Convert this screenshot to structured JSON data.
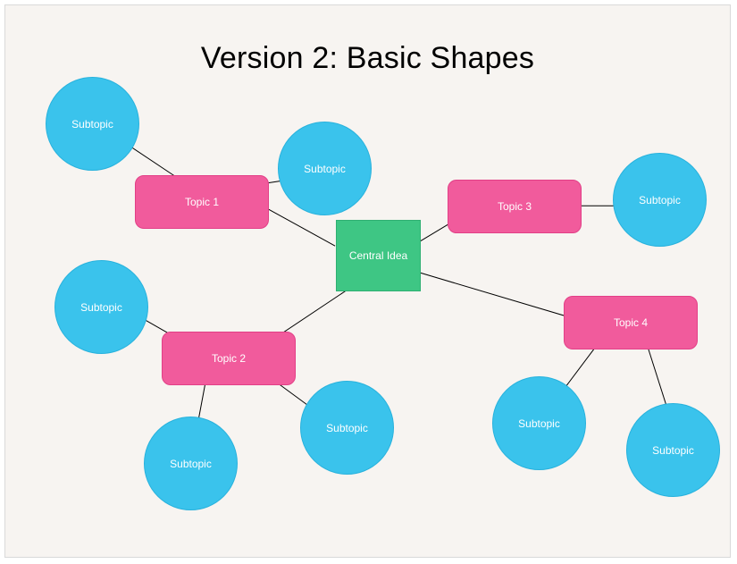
{
  "title": "Version 2: Basic Shapes",
  "colors": {
    "background": "#f7f4f1",
    "central_fill": "#3ec684",
    "topic_fill": "#f15b9c",
    "subtopic_fill": "#3ac3ec",
    "line": "#000000"
  },
  "central": {
    "label": "Central Idea"
  },
  "topics": [
    {
      "label": "Topic 1"
    },
    {
      "label": "Topic 2"
    },
    {
      "label": "Topic 3"
    },
    {
      "label": "Topic 4"
    }
  ],
  "subtopics": [
    {
      "label": "Subtopic"
    },
    {
      "label": "Subtopic"
    },
    {
      "label": "Subtopic"
    },
    {
      "label": "Subtopic"
    },
    {
      "label": "Subtopic"
    },
    {
      "label": "Subtopic"
    },
    {
      "label": "Subtopic"
    },
    {
      "label": "Subtopic"
    }
  ]
}
